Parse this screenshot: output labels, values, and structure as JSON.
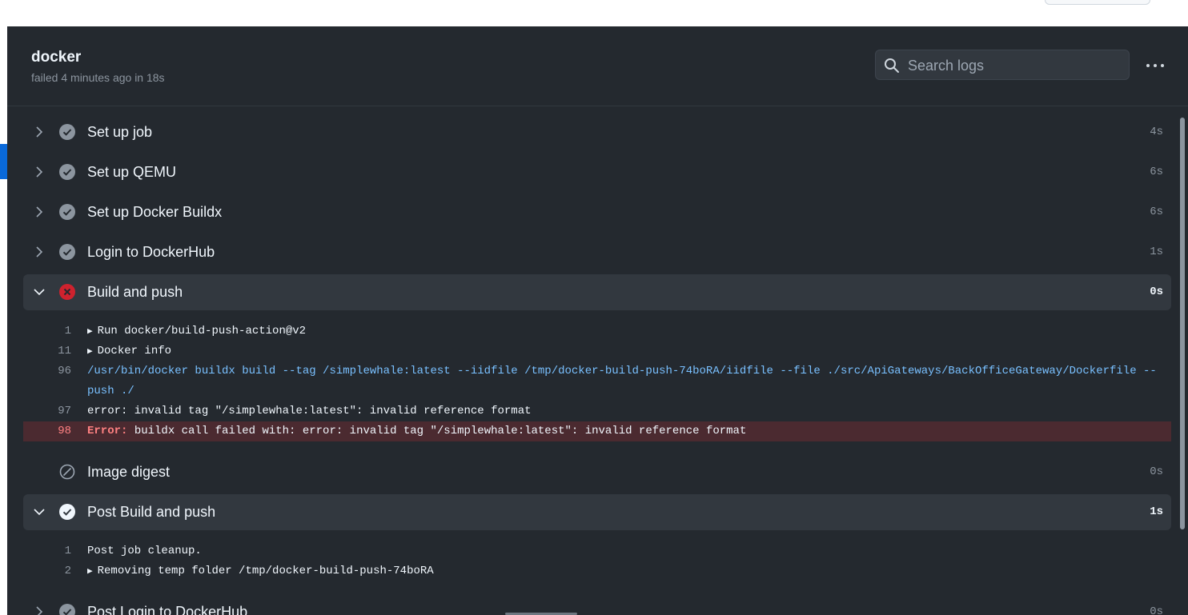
{
  "job": {
    "title": "docker",
    "subtitle": "failed 4 minutes ago in 18s"
  },
  "search": {
    "placeholder": "Search logs",
    "value": ""
  },
  "steps": [
    {
      "name": "Set up job",
      "duration": "4s",
      "status": "success",
      "expanded": false
    },
    {
      "name": "Set up QEMU",
      "duration": "6s",
      "status": "success",
      "expanded": false
    },
    {
      "name": "Set up Docker Buildx",
      "duration": "6s",
      "status": "success",
      "expanded": false
    },
    {
      "name": "Login to DockerHub",
      "duration": "1s",
      "status": "success",
      "expanded": false
    },
    {
      "name": "Build and push",
      "duration": "0s",
      "status": "failure",
      "expanded": true
    },
    {
      "name": "Image digest",
      "duration": "0s",
      "status": "skipped",
      "expanded": false
    },
    {
      "name": "Post Build and push",
      "duration": "1s",
      "status": "success",
      "expanded": true
    },
    {
      "name": "Post Login to DockerHub",
      "duration": "0s",
      "status": "success",
      "expanded": false
    }
  ],
  "build_log": [
    {
      "num": "1",
      "text": "Run docker/build-push-action@v2",
      "group": true
    },
    {
      "num": "11",
      "text": "Docker info",
      "group": true
    },
    {
      "num": "96",
      "text": "/usr/bin/docker buildx build --tag /simplewhale:latest --iidfile /tmp/docker-build-push-74boRA/iidfile --file ./src/ApiGateways/BackOfficeGateway/Dockerfile --push ./",
      "command": true
    },
    {
      "num": "97",
      "text": "error: invalid tag \"/simplewhale:latest\": invalid reference format"
    },
    {
      "num": "98",
      "label": "Error:",
      "text": " buildx call failed with: error: invalid tag \"/simplewhale:latest\": invalid reference format",
      "error": true
    }
  ],
  "post_log": [
    {
      "num": "1",
      "text": "Post job cleanup."
    },
    {
      "num": "2",
      "text": "Removing temp folder /tmp/docker-build-push-74boRA",
      "group": true
    }
  ],
  "colors": {
    "panel_bg": "#24292f",
    "success": "#8c959f",
    "failure": "#cf222e",
    "error_line_bg": "#4b2a30",
    "command_text": "#79c0ff"
  }
}
